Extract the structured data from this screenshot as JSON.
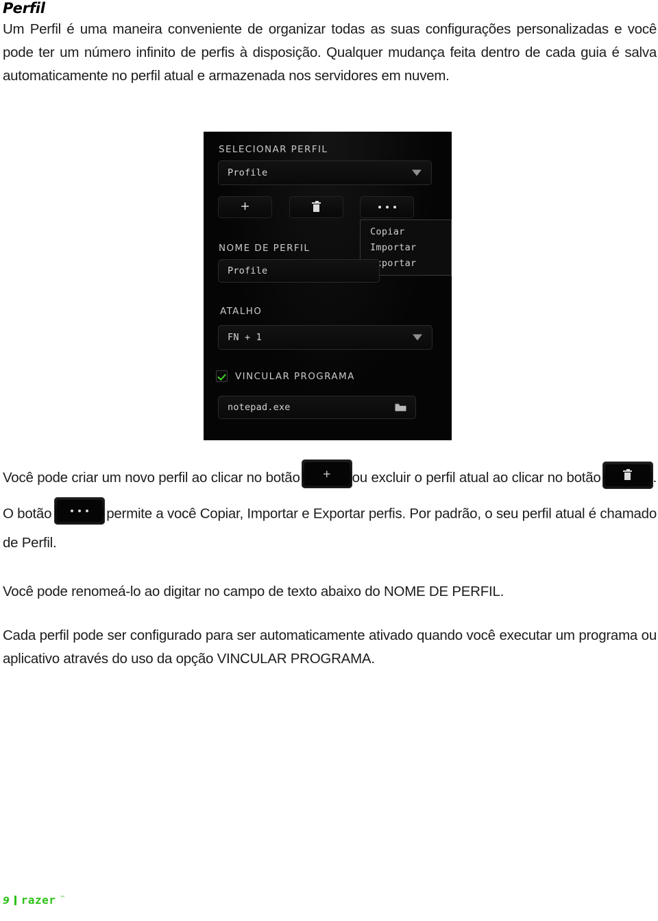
{
  "document": {
    "heading": "Perfil",
    "paragraph_1": "Um Perfil é uma maneira conveniente de organizar todas as suas configurações personalizadas e você pode ter um número infinito de perfis à disposição. Qualquer mudança feita dentro de cada guia é salva automaticamente no perfil atual e armazenada nos servidores em nuvem.",
    "paragraph_2_part_1": "Você pode criar um novo perfil ao clicar no botão",
    "paragraph_2_part_2": "ou excluir o perfil atual ao clicar no botão",
    "paragraph_2_part_3": ". O botão",
    "paragraph_2_part_4": "permite a você Copiar, Importar e Exportar perfis. Por padrão, o seu perfil atual é chamado de Perfil.",
    "paragraph_3": "Você pode renomeá-lo ao digitar no campo de texto abaixo do NOME DE PERFIL.",
    "paragraph_4": "Cada perfil pode ser configurado para ser automaticamente ativado quando você executar um programa ou aplicativo através do uso da opção VINCULAR PROGRAMA."
  },
  "screenshot": {
    "select_profile_label": "SELECIONAR PERFIL",
    "select_profile_value": "Profile",
    "add_button_glyph": "+",
    "delete_button_icon": "trash-icon",
    "more_button_icon": "ellipsis-icon",
    "context_menu": [
      "Copiar",
      "Importar",
      "Exportar"
    ],
    "profile_name_label": "NOME DE PERFIL",
    "profile_name_value": "Profile",
    "shortcut_label": "ATALHO",
    "shortcut_value": "FN + 1",
    "link_program_label": "VINCULAR PROGRAMA",
    "link_program_checked": true,
    "program_path_value": "notepad.exe",
    "browse_icon": "folder-icon",
    "accent_green": "#44d62c",
    "panel_background": "#050505"
  },
  "footer": {
    "page_number": "9",
    "separator": "|",
    "brand": "razer",
    "trademark": "™",
    "brand_color": "#2ec319"
  }
}
